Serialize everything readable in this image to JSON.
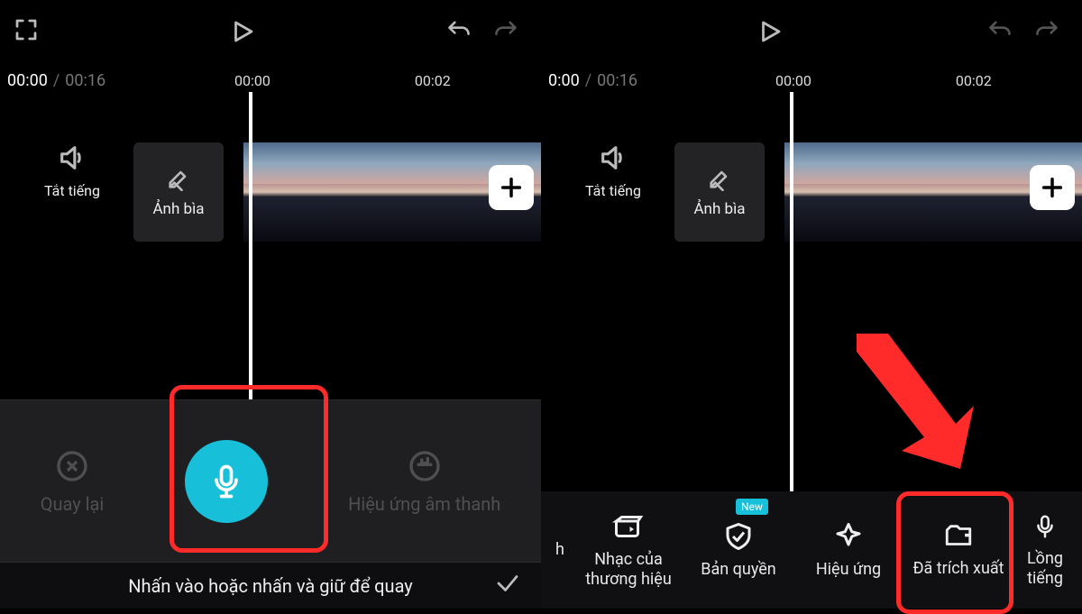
{
  "left": {
    "time": {
      "current": "00:00",
      "duration": "00:16"
    },
    "ticks": [
      "00:00",
      "00:02"
    ],
    "mute_label": "Tắt tiếng",
    "cover_label": "Ảnh bìa",
    "record": {
      "back_label": "Quay lại",
      "sound_fx_label": "Hiệu ứng âm thanh",
      "hint": "Nhấn vào hoặc nhấn và giữ để quay"
    }
  },
  "right": {
    "time": {
      "current": "0:00",
      "duration": "00:16"
    },
    "ticks": [
      "00:00",
      "00:02"
    ],
    "mute_label": "Tắt tiếng",
    "cover_label": "Ảnh bìa",
    "tools": {
      "brand_music": "Nhạc của\nthương hiệu",
      "copyright": "Bản quyền",
      "copyright_badge": "New",
      "effects": "Hiệu ứng",
      "extracted": "Đã trích xuất",
      "voiceover": "Lồng tiếng"
    }
  }
}
